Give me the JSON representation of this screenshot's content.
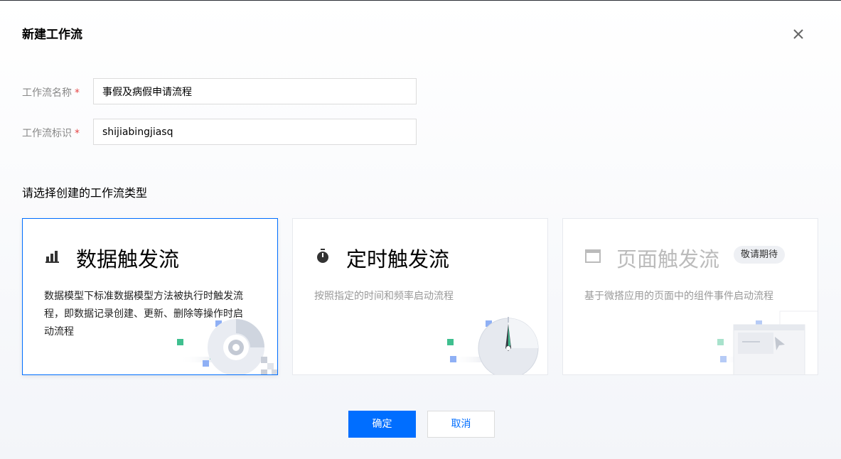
{
  "dialog": {
    "title": "新建工作流"
  },
  "form": {
    "name_label": "工作流名称",
    "name_value": "事假及病假申请流程",
    "id_label": "工作流标识",
    "id_value": "shijiabingjiasq",
    "required_mark": "*"
  },
  "section_title": "请选择创建的工作流类型",
  "cards": [
    {
      "title": "数据触发流",
      "icon": "bar-chart-icon",
      "desc": "数据模型下标准数据模型方法被执行时触发流程，即数据记录创建、更新、删除等操作时启动流程",
      "selected": true
    },
    {
      "title": "定时触发流",
      "icon": "stopwatch-icon",
      "desc": "按照指定的时间和频率启动流程",
      "selected": false
    },
    {
      "title": "页面触发流",
      "icon": "window-icon",
      "desc": "基于微搭应用的页面中的组件事件启动流程",
      "badge": "敬请期待",
      "disabled": true
    }
  ],
  "buttons": {
    "confirm": "确定",
    "cancel": "取消"
  },
  "colors": {
    "primary": "#006eff",
    "required": "#e54545",
    "accent_green": "#3fbf8f",
    "accent_blue": "#8fb0f5"
  }
}
